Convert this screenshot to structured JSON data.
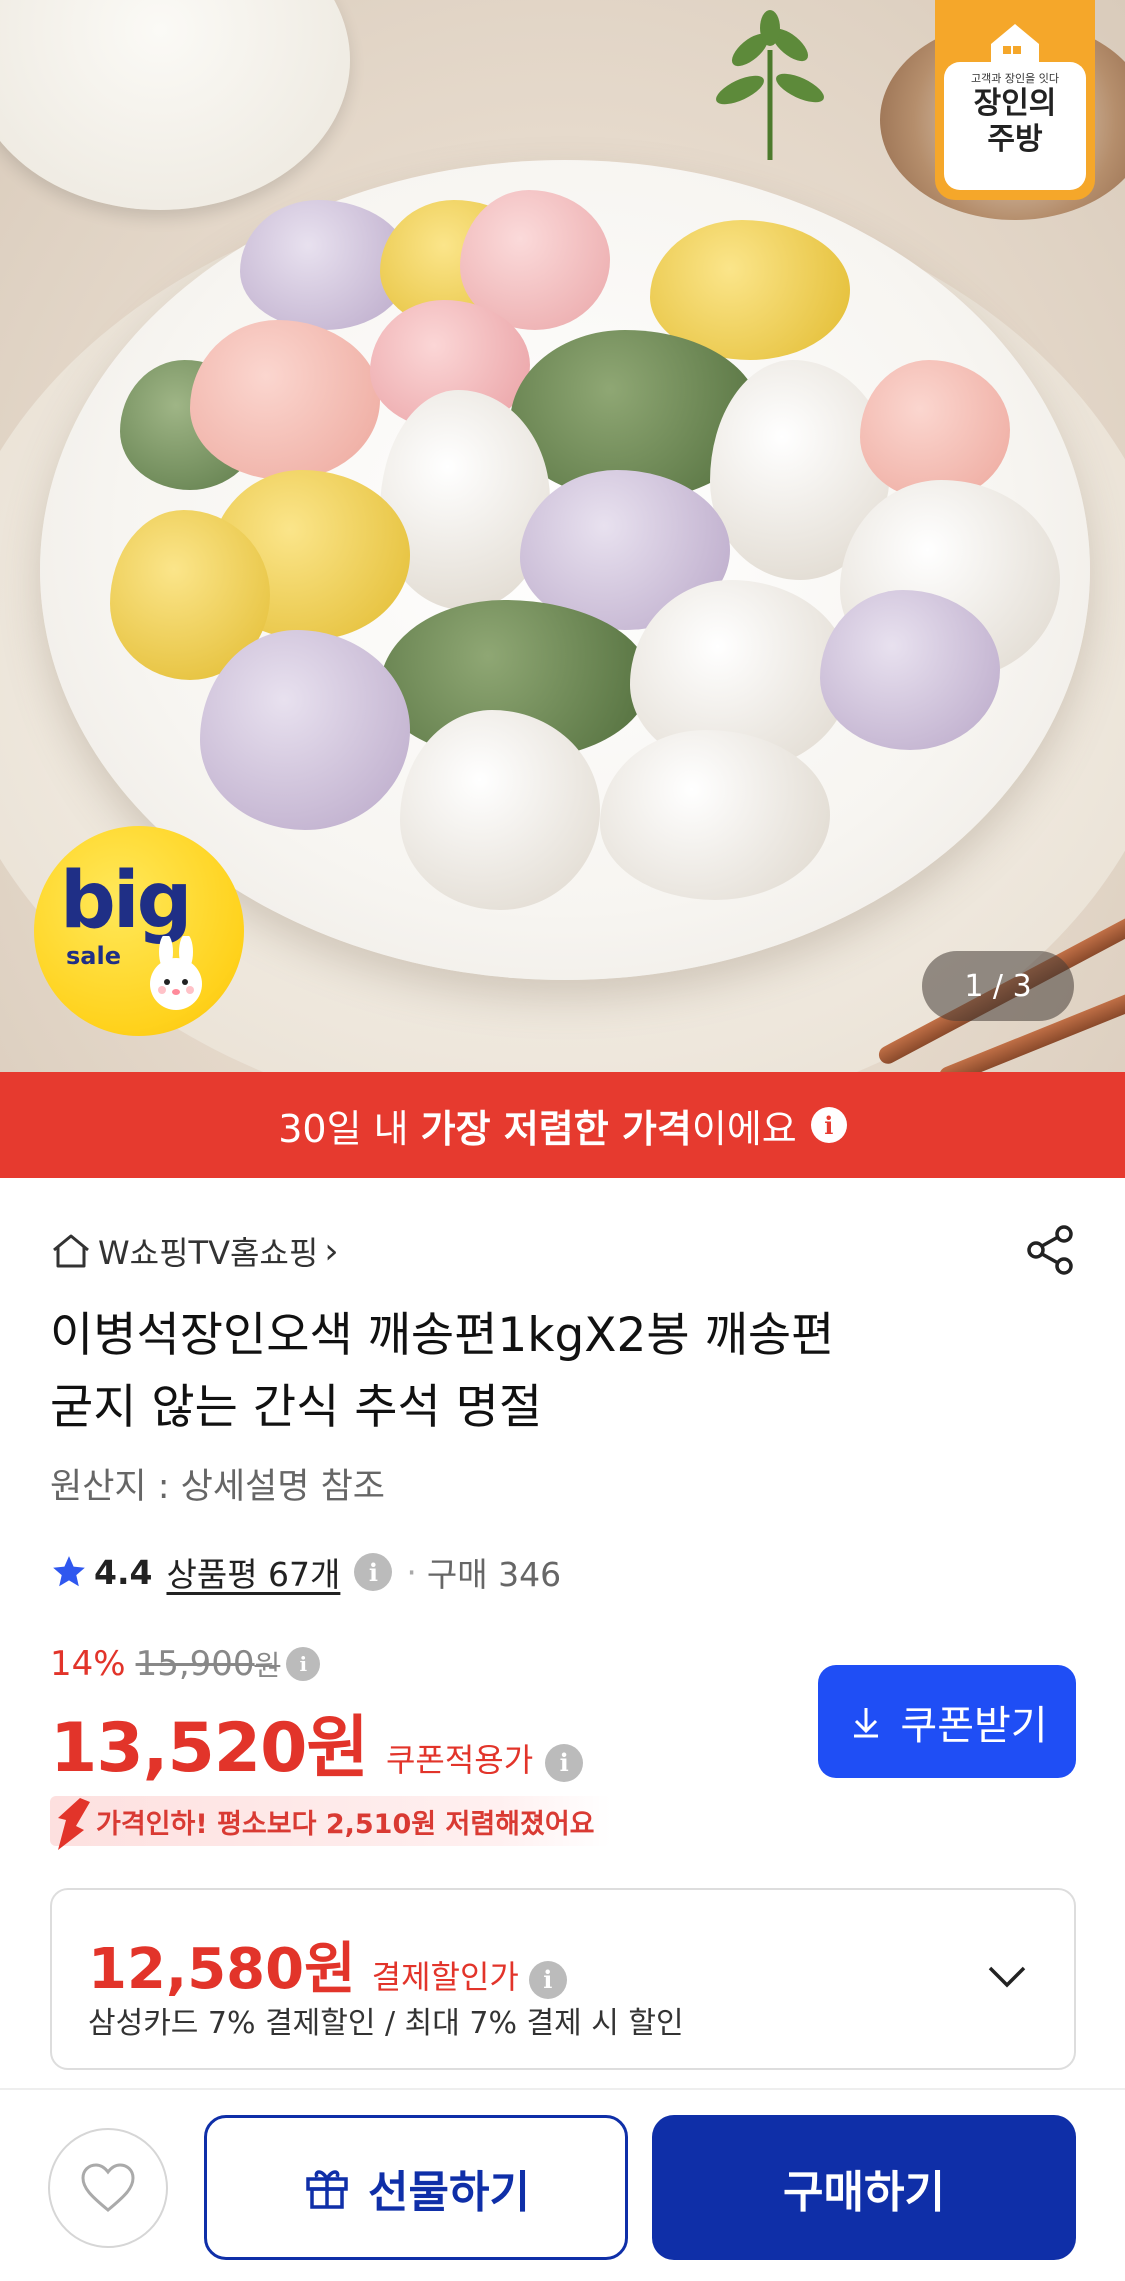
{
  "hero": {
    "brand_tagline": "고객과 장인을 잇다",
    "brand_name": "장인의\n주방",
    "sale_badge_big": "big",
    "sale_badge_sale": "sale",
    "pager": "1 / 3"
  },
  "banner": {
    "prefix": "30일 내 ",
    "emphasis": "가장 저렴한 가격",
    "suffix": "이에요",
    "info_icon": "info-icon"
  },
  "product": {
    "seller": "W쇼핑TV홈쇼핑",
    "seller_chevron": "›",
    "title_line1": "이병석장인오색 깨송편1kgX2봉 깨송편",
    "title_line2": "굳지 않는 간식 추석 명절",
    "origin": "원산지 : 상세설명 참조",
    "rating": "4.4",
    "review_label": "상품평 67개",
    "purchase_label": "구매 346"
  },
  "price": {
    "discount_rate": "14%",
    "original_price": "15,900",
    "original_unit": "원",
    "current_price": "13,520원",
    "current_label": "쿠폰적용가",
    "coupon_button": "쿠폰받기",
    "drop_message": "가격인하! 평소보다 2,510원 저렴해졌어요"
  },
  "payment": {
    "price": "12,580원",
    "label": "결제할인가",
    "description": "삼성카드 7% 결제할인 / 최대 7% 결제 시 할인"
  },
  "bottom": {
    "gift_button": "선물하기",
    "buy_button": "구매하기"
  },
  "colors": {
    "banner_red": "#e63a2f",
    "price_red": "#e2342a",
    "coupon_blue": "#1f4ef5",
    "navy": "#0f2fa8",
    "brand_orange": "#f5a72a"
  }
}
